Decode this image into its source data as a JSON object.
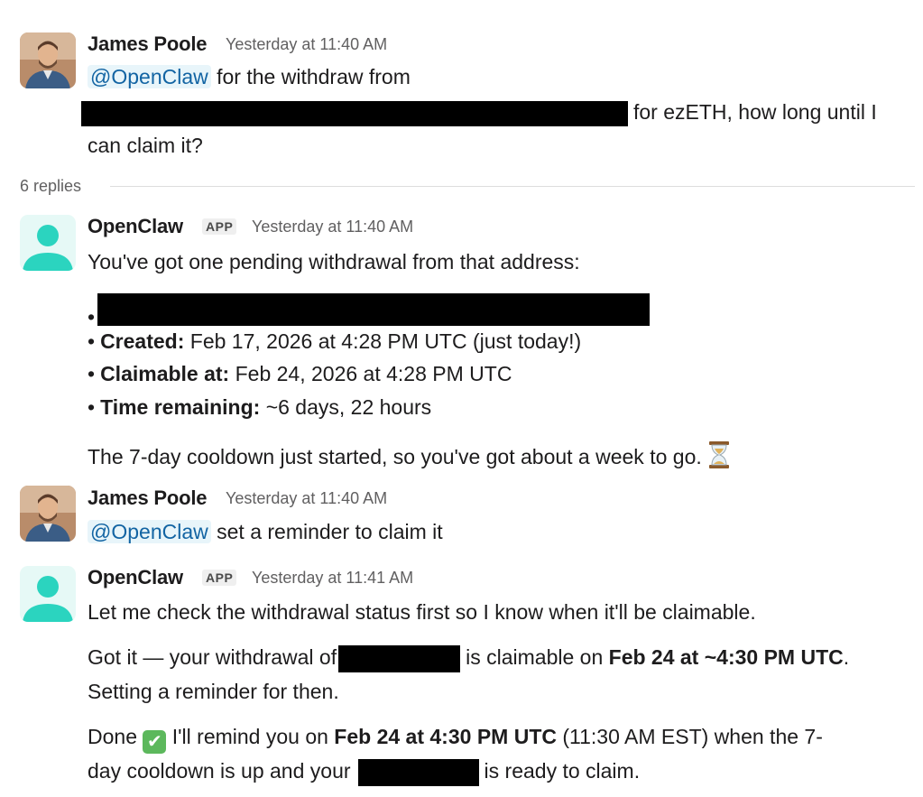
{
  "messages": [
    {
      "author": "James Poole",
      "time": "Yesterday at 11:40 AM",
      "mention": "@OpenClaw",
      "text1": "for the withdraw from",
      "text2": "for ezETH, how long until I",
      "text3": "can claim it?"
    },
    {
      "author": "OpenClaw",
      "badge": "APP",
      "time": "Yesterday at 11:40 AM",
      "intro": "You've got one pending withdrawal from that address:",
      "bullets": [
        {
          "label": "Created:",
          "value": "Feb 17, 2026 at 4:28 PM UTC (just today!)"
        },
        {
          "label": "Claimable at:",
          "value": "Feb 24, 2026 at 4:28 PM UTC"
        },
        {
          "label": "Time remaining:",
          "value": "~6 days, 22 hours"
        }
      ],
      "closing": "The 7-day cooldown just started, so you've got about a week to go."
    },
    {
      "author": "James Poole",
      "time": "Yesterday at 11:40 AM",
      "mention": "@OpenClaw",
      "text": "set a reminder to claim it"
    },
    {
      "author": "OpenClaw",
      "badge": "APP",
      "time": "Yesterday at 11:41 AM",
      "p1": "Let me check the withdrawal status first so I know when it'll be claimable.",
      "p2a": "Got it — your withdrawal of",
      "p2b": "is claimable on",
      "p2c": "Feb 24 at ~4:30 PM UTC",
      "p2d": ".",
      "p2e": "Setting a reminder for then.",
      "p3a": "Done",
      "p3b": "I'll remind you on",
      "p3c": "Feb 24 at 4:30 PM UTC",
      "p3d": "(11:30 AM EST) when the 7-",
      "p3e": "day cooldown is up and your",
      "p3f": "is ready to claim."
    }
  ],
  "thread": {
    "replies_label": "6 replies"
  },
  "icons": {
    "reply_emoji_1": "hourglass-icon",
    "reply_emoji_2": "check-mark-icon"
  },
  "colors": {
    "mention_bg": "#e8f5fa",
    "mention_text": "#1264a3",
    "app_avatar": "#2bd4bf",
    "check": "#5cb85c"
  }
}
